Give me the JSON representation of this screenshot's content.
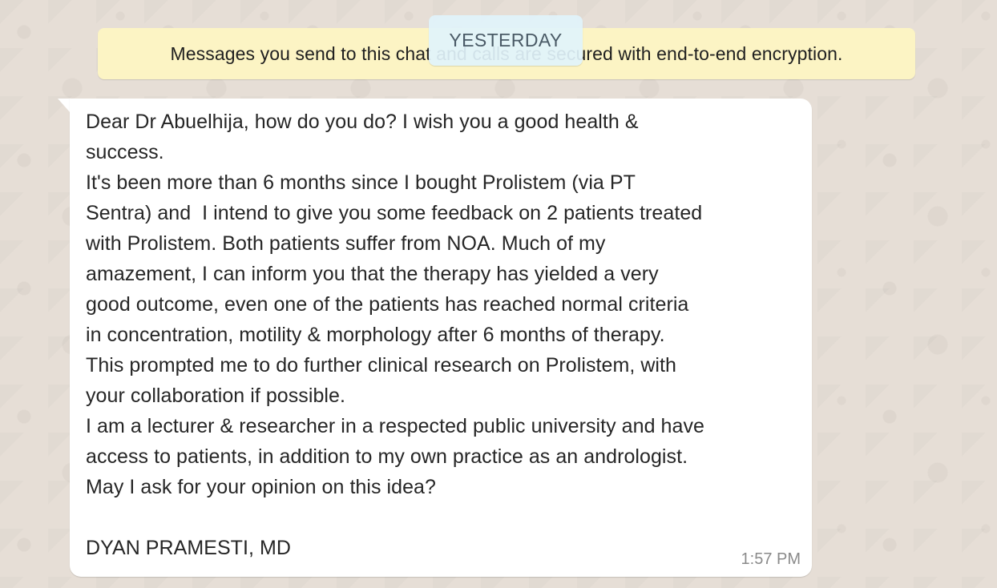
{
  "encryption_notice": {
    "text": "Messages you send to this chat and calls are secured with end-to-end encryption."
  },
  "date_chip": {
    "label": "YESTERDAY"
  },
  "message": {
    "lines": [
      "Dear Dr Abuelhija, how do you do? I wish you a good health &",
      "success.",
      "It's been more than 6 months since I bought Prolistem (via PT",
      "Sentra) and  I intend to give you some feedback on 2 patients treated",
      "with Prolistem. Both patients suffer from NOA. Much of my",
      "amazement, I can inform you that the therapy has yielded a very",
      "good outcome, even one of the patients has reached normal criteria",
      "in concentration, motility & morphology after 6 months of therapy.",
      "This prompted me to do further clinical research on Prolistem, with",
      "your collaboration if possible.",
      "I am a lecturer & researcher in a respected public university and have",
      "access to patients, in addition to my own practice as an andrologist.",
      "May I ask for your opinion on this idea?",
      "",
      "DYAN PRAMESTI, MD"
    ],
    "time": "1:57 PM"
  },
  "colors": {
    "background": "#e5ddd5",
    "notice_bg": "#fcf4c4",
    "date_chip_bg": "#e1f3fb",
    "bubble_bg": "#ffffff"
  }
}
